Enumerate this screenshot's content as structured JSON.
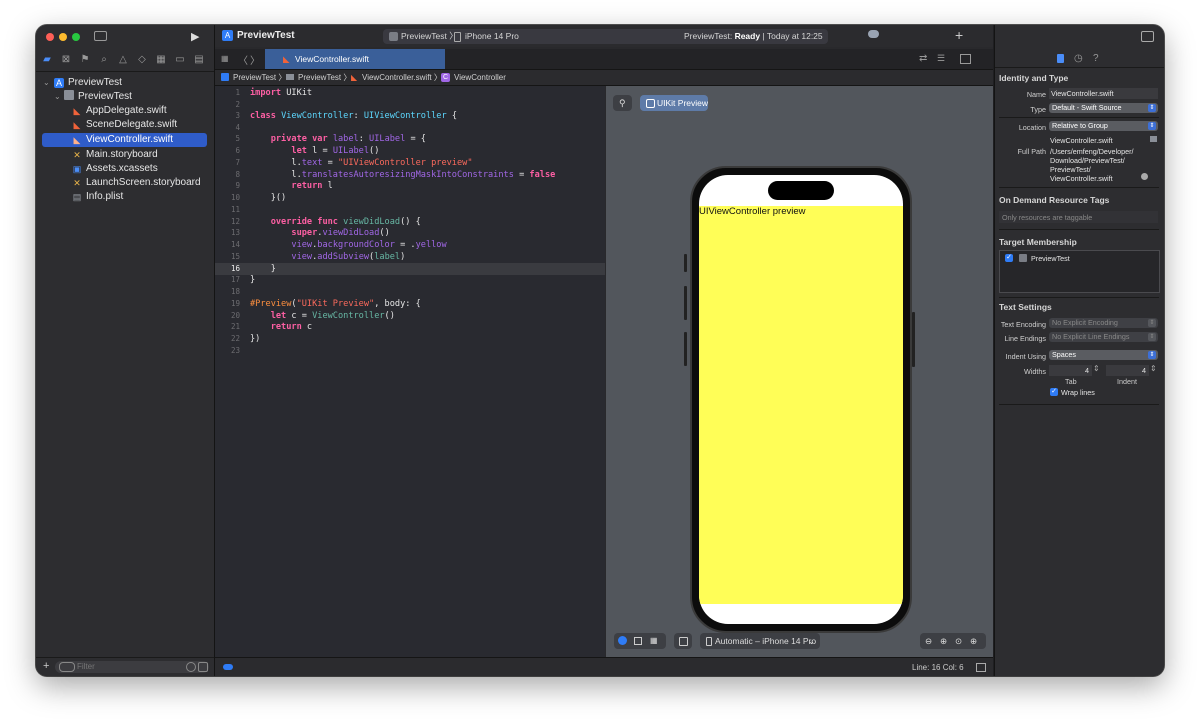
{
  "toolbar": {
    "project_title": "PreviewTest",
    "scheme": "PreviewTest",
    "device": "iPhone 14 Pro",
    "status_project": "PreviewTest:",
    "status_state": "Ready",
    "status_time": "| Today at 12:25 pm"
  },
  "tabs": [
    {
      "label": "ViewController.swift"
    }
  ],
  "jumpbar": [
    "PreviewTest",
    "PreviewTest",
    "ViewController.swift",
    "ViewController"
  ],
  "navigator": {
    "items": [
      {
        "label": "PreviewTest",
        "icon": "project-icon"
      },
      {
        "label": "PreviewTest",
        "icon": "folder-icon"
      },
      {
        "label": "AppDelegate.swift",
        "icon": "swift-icon"
      },
      {
        "label": "SceneDelegate.swift",
        "icon": "swift-icon"
      },
      {
        "label": "ViewController.swift",
        "icon": "swift-icon"
      },
      {
        "label": "Main.storyboard",
        "icon": "storyboard-icon"
      },
      {
        "label": "Assets.xcassets",
        "icon": "assets-icon"
      },
      {
        "label": "LaunchScreen.storyboard",
        "icon": "storyboard-icon"
      },
      {
        "label": "Info.plist",
        "icon": "plist-icon"
      }
    ],
    "filter_placeholder": "Filter"
  },
  "editor": {
    "line_numbers": [
      "1",
      "2",
      "3",
      "4",
      "5",
      "6",
      "7",
      "8",
      "9",
      "10",
      "11",
      "12",
      "13",
      "14",
      "15",
      "16",
      "17",
      "18",
      "19",
      "20",
      "21",
      "22",
      "23"
    ],
    "current_line": 16
  },
  "preview": {
    "pin_label": "",
    "preview_button": "UIKit Preview",
    "label_text": "UIViewController preview",
    "device_menu": "Automatic – iPhone 14 Pro",
    "screen_color": "#fffe57"
  },
  "statusline": {
    "position": "Line: 16  Col: 6"
  },
  "inspector": {
    "identity_title": "Identity and Type",
    "name_label": "Name",
    "name_value": "ViewController.swift",
    "type_label": "Type",
    "type_value": "Default - Swift Source",
    "location_label": "Location",
    "location_value": "Relative to Group",
    "location_file": "ViewController.swift",
    "fullpath_label": "Full Path",
    "fullpath_lines": [
      "/Users/emfeng/Developer/",
      "Download/PreviewTest/",
      "PreviewTest/",
      "ViewController.swift"
    ],
    "odr_title": "On Demand Resource Tags",
    "odr_placeholder": "Only resources are taggable",
    "target_title": "Target Membership",
    "target_name": "PreviewTest",
    "text_title": "Text Settings",
    "encoding_label": "Text Encoding",
    "encoding_value": "No Explicit Encoding",
    "endings_label": "Line Endings",
    "endings_value": "No Explicit Line Endings",
    "indent_label": "Indent Using",
    "indent_value": "Spaces",
    "widths_label": "Widths",
    "tab_value": "4",
    "indent_value_num": "4",
    "tab_caption": "Tab",
    "indent_caption": "Indent",
    "wrap_label": "Wrap lines"
  }
}
